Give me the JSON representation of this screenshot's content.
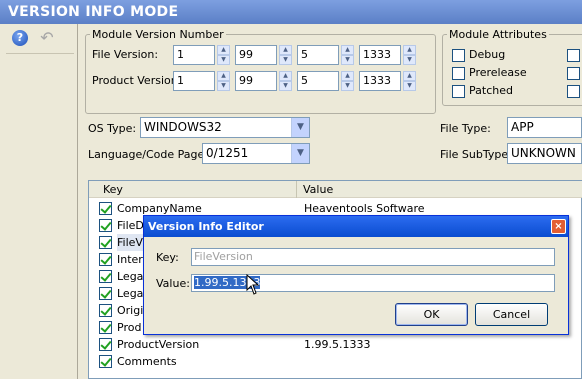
{
  "window": {
    "title": "VERSION INFO MODE"
  },
  "toolbar": {
    "help_icon": "help-icon",
    "undo_icon": "undo-icon"
  },
  "module_version": {
    "legend": "Module Version Number",
    "file_version_label": "File Version:",
    "product_version_label": "Product Version:",
    "file_version": [
      "1",
      "99",
      "5",
      "1333"
    ],
    "product_version": [
      "1",
      "99",
      "5",
      "1333"
    ]
  },
  "module_attributes": {
    "legend": "Module Attributes",
    "items": [
      "Debug",
      "Prerelease",
      "Patched"
    ]
  },
  "os_type": {
    "label": "OS Type:",
    "value": "WINDOWS32"
  },
  "language": {
    "label": "Language/Code Page:",
    "value": "0/1251"
  },
  "file_type": {
    "label": "File Type:",
    "value": "APP"
  },
  "file_subtype": {
    "label": "File SubType:",
    "value": "UNKNOWN"
  },
  "list": {
    "columns": [
      "Key",
      "Value"
    ],
    "rows": [
      {
        "key": "CompanyName",
        "value": "Heaventools Software"
      },
      {
        "key": "FileD",
        "value": ""
      },
      {
        "key": "FileV",
        "value": ""
      },
      {
        "key": "Intern",
        "value": ""
      },
      {
        "key": "Lega",
        "value": ""
      },
      {
        "key": "Lega",
        "value": ""
      },
      {
        "key": "Origi",
        "value": ""
      },
      {
        "key": "Prod",
        "value": ""
      },
      {
        "key": "ProductVersion",
        "value": "1.99.5.1333"
      },
      {
        "key": "Comments",
        "value": ""
      }
    ]
  },
  "dialog": {
    "title": "Version Info Editor",
    "key_label": "Key:",
    "key_value": "FileVersion",
    "value_label": "Value:",
    "value_value": "1.99.5.1333",
    "ok": "OK",
    "cancel": "Cancel",
    "close": "×"
  }
}
